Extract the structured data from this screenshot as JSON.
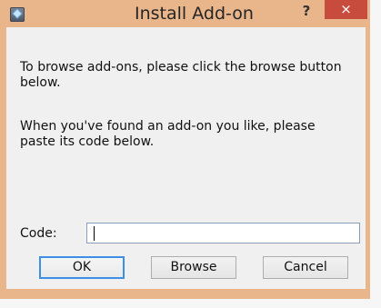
{
  "window": {
    "title": "Install Add-on",
    "help_label": "?",
    "close_label": "×"
  },
  "dialog": {
    "message_1": "To browse add-ons, please click the browse button below.",
    "message_2": "When you've found an add-on you like, please paste its code below.",
    "code_label": "Code:",
    "code_value": ""
  },
  "buttons": {
    "ok": "OK",
    "browse": "Browse",
    "cancel": "Cancel"
  },
  "colors": {
    "titlebar": "#e9b58a",
    "close": "#c84c3e",
    "client": "#f0f0f0"
  }
}
